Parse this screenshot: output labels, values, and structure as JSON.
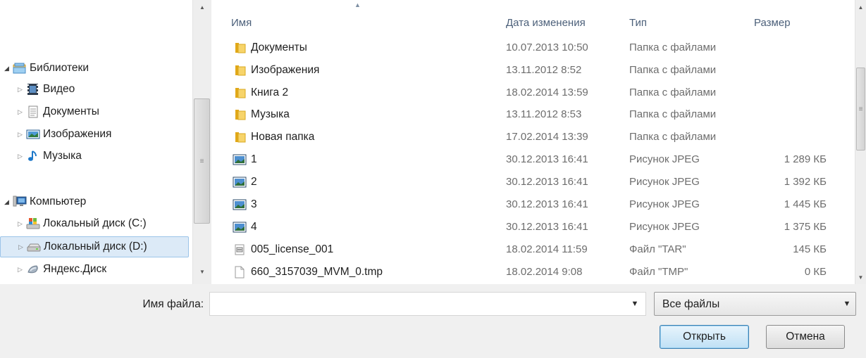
{
  "nav": {
    "items": [
      {
        "label": "Библиотеки",
        "icon": "libraries-icon",
        "arrow": "expanded",
        "level": 0
      },
      {
        "label": "Видео",
        "icon": "video-library-icon",
        "arrow": "collapsed",
        "level": 1
      },
      {
        "label": "Документы",
        "icon": "documents-library-icon",
        "arrow": "collapsed",
        "level": 1
      },
      {
        "label": "Изображения",
        "icon": "pictures-library-icon",
        "arrow": "collapsed",
        "level": 1
      },
      {
        "label": "Музыка",
        "icon": "music-library-icon",
        "arrow": "collapsed",
        "level": 1
      },
      {
        "label": "Компьютер",
        "icon": "computer-icon",
        "arrow": "expanded",
        "level": 0
      },
      {
        "label": "Локальный диск (C:)",
        "icon": "system-drive-icon",
        "arrow": "collapsed",
        "level": 1
      },
      {
        "label": "Локальный диск (D:)",
        "icon": "drive-icon",
        "arrow": "collapsed",
        "level": 1,
        "selected": true
      },
      {
        "label": "Яндекс.Диск",
        "icon": "yandex-disk-icon",
        "arrow": "collapsed",
        "level": 1
      }
    ]
  },
  "columns": {
    "name": "Имя",
    "date": "Дата изменения",
    "type": "Тип",
    "size": "Размер"
  },
  "files": [
    {
      "name": "Документы",
      "date": "10.07.2013 10:50",
      "type": "Папка с файлами",
      "size": "",
      "icon": "folder-icon"
    },
    {
      "name": "Изображения",
      "date": "13.11.2012 8:52",
      "type": "Папка с файлами",
      "size": "",
      "icon": "folder-icon"
    },
    {
      "name": "Книга 2",
      "date": "18.02.2014 13:59",
      "type": "Папка с файлами",
      "size": "",
      "icon": "folder-icon"
    },
    {
      "name": "Музыка",
      "date": "13.11.2012 8:53",
      "type": "Папка с файлами",
      "size": "",
      "icon": "folder-icon"
    },
    {
      "name": "Новая папка",
      "date": "17.02.2014 13:39",
      "type": "Папка с файлами",
      "size": "",
      "icon": "folder-icon"
    },
    {
      "name": "1",
      "date": "30.12.2013 16:41",
      "type": "Рисунок JPEG",
      "size": "1 289 КБ",
      "icon": "image-file-icon"
    },
    {
      "name": "2",
      "date": "30.12.2013 16:41",
      "type": "Рисунок JPEG",
      "size": "1 392 КБ",
      "icon": "image-file-icon"
    },
    {
      "name": "3",
      "date": "30.12.2013 16:41",
      "type": "Рисунок JPEG",
      "size": "1 445 КБ",
      "icon": "image-file-icon"
    },
    {
      "name": "4",
      "date": "30.12.2013 16:41",
      "type": "Рисунок JPEG",
      "size": "1 375 КБ",
      "icon": "image-file-icon"
    },
    {
      "name": "005_license_001",
      "date": "18.02.2014 11:59",
      "type": "Файл \"TAR\"",
      "size": "145 КБ",
      "icon": "archive-file-icon"
    },
    {
      "name": "660_3157039_MVM_0.tmp",
      "date": "18.02.2014 9:08",
      "type": "Файл \"TMP\"",
      "size": "0 КБ",
      "icon": "blank-file-icon"
    }
  ],
  "bottom": {
    "filename_label": "Имя файла:",
    "filename_value": "",
    "filter_value": "Все файлы",
    "open_label": "Открыть",
    "cancel_label": "Отмена"
  },
  "colors": {
    "selection_bg": "#dceaf7",
    "selection_border": "#9cc4e8",
    "header_text": "#4c607a",
    "default_button_border": "#3c7fb1"
  }
}
